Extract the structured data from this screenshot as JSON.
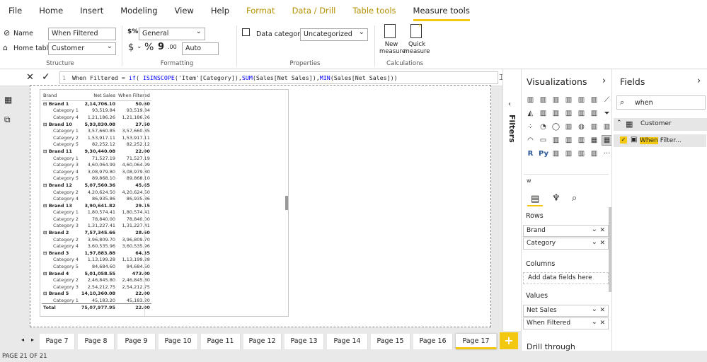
{
  "menu": [
    "File",
    "Home",
    "Insert",
    "Modeling",
    "View",
    "Help",
    "Format",
    "Data / Drill",
    "Table tools",
    "Measure tools"
  ],
  "structure": {
    "name_label": "Name",
    "name_value": "When Filtered",
    "home_table_label": "Home table",
    "home_table_value": "Customer",
    "group": "Structure"
  },
  "formatting": {
    "format_value": "General",
    "currency": "$",
    "percent": "%",
    "comma": "9",
    "decimals": ".00",
    "auto_value": "Auto",
    "group": "Formatting"
  },
  "properties": {
    "data_category_label": "Data category",
    "data_category_value": "Uncategorized",
    "group": "Properties"
  },
  "calculations": {
    "new_measure": "New measure",
    "quick_measure": "Quick measure",
    "group": "Calculations"
  },
  "formula": {
    "line": "1",
    "text": "When Filtered = if( ISINSCOPE('Item'[Category]),SUM(Sales[Net Sales]),MIN(Sales[Net Sales]))"
  },
  "table": {
    "headers": [
      "Brand",
      "Net Sales",
      "When Filtered"
    ],
    "rows": [
      {
        "t": "b",
        "c": [
          "Brand 1",
          "2,14,706.10",
          "50.60"
        ]
      },
      {
        "t": "c",
        "c": [
          "Category 1",
          "93,519.84",
          "93,519.84"
        ]
      },
      {
        "t": "c",
        "c": [
          "Category 4",
          "1,21,186.26",
          "1,21,186.26"
        ]
      },
      {
        "t": "b",
        "c": [
          "Brand 10",
          "5,93,830.08",
          "27.50"
        ]
      },
      {
        "t": "c",
        "c": [
          "Category 1",
          "3,57,660.85",
          "3,57,660.85"
        ]
      },
      {
        "t": "c",
        "c": [
          "Category 2",
          "1,53,917.11",
          "1,53,917.11"
        ]
      },
      {
        "t": "c",
        "c": [
          "Category 5",
          "82,252.12",
          "82,252.12"
        ]
      },
      {
        "t": "b",
        "c": [
          "Brand 11",
          "9,30,440.08",
          "22.00"
        ]
      },
      {
        "t": "c",
        "c": [
          "Category 1",
          "71,527.19",
          "71,527.19"
        ]
      },
      {
        "t": "c",
        "c": [
          "Category 3",
          "4,60,064.99",
          "4,60,064.99"
        ]
      },
      {
        "t": "c",
        "c": [
          "Category 4",
          "3,08,979.80",
          "3,08,979.80"
        ]
      },
      {
        "t": "c",
        "c": [
          "Category 5",
          "89,868.10",
          "89,868.10"
        ]
      },
      {
        "t": "b",
        "c": [
          "Brand 12",
          "5,07,560.36",
          "45.65"
        ]
      },
      {
        "t": "c",
        "c": [
          "Category 2",
          "4,20,624.50",
          "4,20,624.50"
        ]
      },
      {
        "t": "c",
        "c": [
          "Category 4",
          "86,935.86",
          "86,935.86"
        ]
      },
      {
        "t": "b",
        "c": [
          "Brand 13",
          "3,90,641.82",
          "29.15"
        ]
      },
      {
        "t": "c",
        "c": [
          "Category 1",
          "1,80,574.41",
          "1,80,574.41"
        ]
      },
      {
        "t": "c",
        "c": [
          "Category 2",
          "78,840.00",
          "78,840.00"
        ]
      },
      {
        "t": "c",
        "c": [
          "Category 3",
          "1,31,227.41",
          "1,31,227.41"
        ]
      },
      {
        "t": "b",
        "c": [
          "Brand 2",
          "7,57,345.66",
          "28.60"
        ]
      },
      {
        "t": "c",
        "c": [
          "Category 2",
          "3,96,809.70",
          "3,96,809.70"
        ]
      },
      {
        "t": "c",
        "c": [
          "Category 4",
          "3,60,535.96",
          "3,60,535.96"
        ]
      },
      {
        "t": "b",
        "c": [
          "Brand 3",
          "1,97,883.88",
          "64.35"
        ]
      },
      {
        "t": "c",
        "c": [
          "Category 4",
          "1,13,199.28",
          "1,13,199.28"
        ]
      },
      {
        "t": "c",
        "c": [
          "Category 5",
          "84,684.60",
          "84,684.60"
        ]
      },
      {
        "t": "b",
        "c": [
          "Brand 4",
          "5,01,058.55",
          "473.00"
        ]
      },
      {
        "t": "c",
        "c": [
          "Category 2",
          "2,46,845.80",
          "2,46,845.80"
        ]
      },
      {
        "t": "c",
        "c": [
          "Category 3",
          "2,54,212.75",
          "2,54,212.75"
        ]
      },
      {
        "t": "b",
        "c": [
          "Brand 5",
          "14,10,360.08",
          "22.00"
        ]
      },
      {
        "t": "c",
        "c": [
          "Category 1",
          "45,183.20",
          "45,183.20"
        ]
      }
    ],
    "total": [
      "Total",
      "75,07,977.95",
      "22.00"
    ]
  },
  "filters_label": "Filters",
  "viz": {
    "title": "Visualizations",
    "search_letter": "w",
    "rows_label": "Rows",
    "rows": [
      "Brand",
      "Category"
    ],
    "columns_label": "Columns",
    "columns_placeholder": "Add data fields here",
    "values_label": "Values",
    "values": [
      "Net Sales",
      "When Filtered"
    ],
    "drill": "Drill through"
  },
  "fields": {
    "title": "Fields",
    "search_value": "when",
    "table": "Customer",
    "measure": "When Filter..."
  },
  "tabs": [
    "Page 7",
    "Page 8",
    "Page 9",
    "Page 10",
    "Page 11",
    "Page 12",
    "Page 13",
    "Page 14",
    "Page 15",
    "Page 16",
    "Page 17"
  ],
  "active_tab": "Page 17",
  "add_tab": "+",
  "status": "PAGE 21 OF 21",
  "colors": {
    "accent": "#f2c811",
    "context_tab": "#b58f00",
    "formula_fn": "#0000ff"
  }
}
